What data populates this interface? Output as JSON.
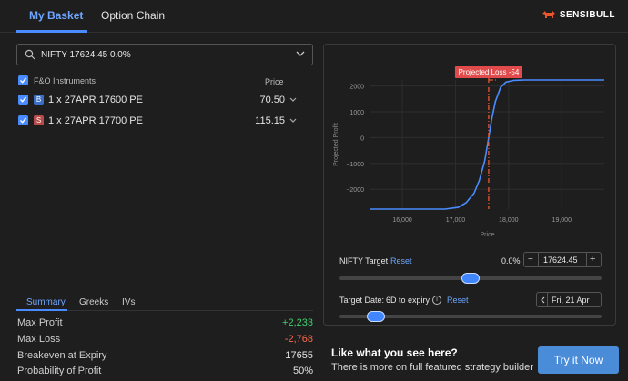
{
  "tabs": {
    "basket": "My Basket",
    "chain": "Option Chain"
  },
  "brand": {
    "name": "SENSIBULL"
  },
  "search": {
    "value": "NIFTY 17624.45 0.0%"
  },
  "instruments": {
    "header": "F&O Instruments",
    "price_header": "Price",
    "rows": [
      {
        "side": "B",
        "label": "1 x 27APR 17600 PE",
        "price": "70.50"
      },
      {
        "side": "S",
        "label": "1 x 27APR 17700 PE",
        "price": "115.15"
      }
    ]
  },
  "summary_tabs": {
    "summary": "Summary",
    "greeks": "Greeks",
    "ivs": "IVs"
  },
  "stats": [
    {
      "label": "Max Profit",
      "value": "+2,233",
      "color": "#3ecf6e"
    },
    {
      "label": "Max Loss",
      "value": "-2,768",
      "color": "#ff6b4a"
    },
    {
      "label": "Breakeven at Expiry",
      "value": "17655",
      "color": "#e6e6e6"
    },
    {
      "label": "Probability of Profit",
      "value": "50%",
      "color": "#e6e6e6"
    }
  ],
  "chart_data": {
    "type": "line",
    "annotation": "Projected Loss -54",
    "xlabel": "Price",
    "ylabel": "Projected Profit",
    "x_ticks": [
      "16,000",
      "17,000",
      "18,000",
      "19,000"
    ],
    "y_ticks": [
      "2000",
      "1000",
      "0",
      "−1000",
      "−2000"
    ],
    "xlim": [
      15400,
      19800
    ],
    "ylim": [
      -2768,
      2233
    ],
    "grid": true,
    "series": [
      {
        "x": [
          15400,
          16800,
          17050,
          17200,
          17350,
          17450,
          17550,
          17620,
          17680,
          17750,
          17850,
          17950,
          18100,
          18300,
          19800
        ],
        "y": [
          -2768,
          -2768,
          -2700,
          -2520,
          -2150,
          -1650,
          -900,
          -54,
          700,
          1400,
          1950,
          2150,
          2220,
          2233,
          2233
        ]
      }
    ],
    "target_x": 17624.45,
    "colors": {
      "line": "#4a8cff",
      "target": "#e8552f",
      "label_bg": "#e24b4b"
    }
  },
  "target": {
    "label": "NIFTY Target",
    "reset": "Reset",
    "pct": "0.0%",
    "minus": "−",
    "value": "17624.45",
    "plus": "+",
    "slider_fraction": 0.5
  },
  "date": {
    "label": "Target Date:",
    "days": "6D to expiry",
    "info": "i",
    "reset": "Reset",
    "value": "Fri, 21 Apr",
    "slider_fraction": 0.1
  },
  "cta": {
    "title": "Like what you see here?",
    "subtitle": "There is more on full featured strategy builder",
    "button": "Try it Now"
  }
}
